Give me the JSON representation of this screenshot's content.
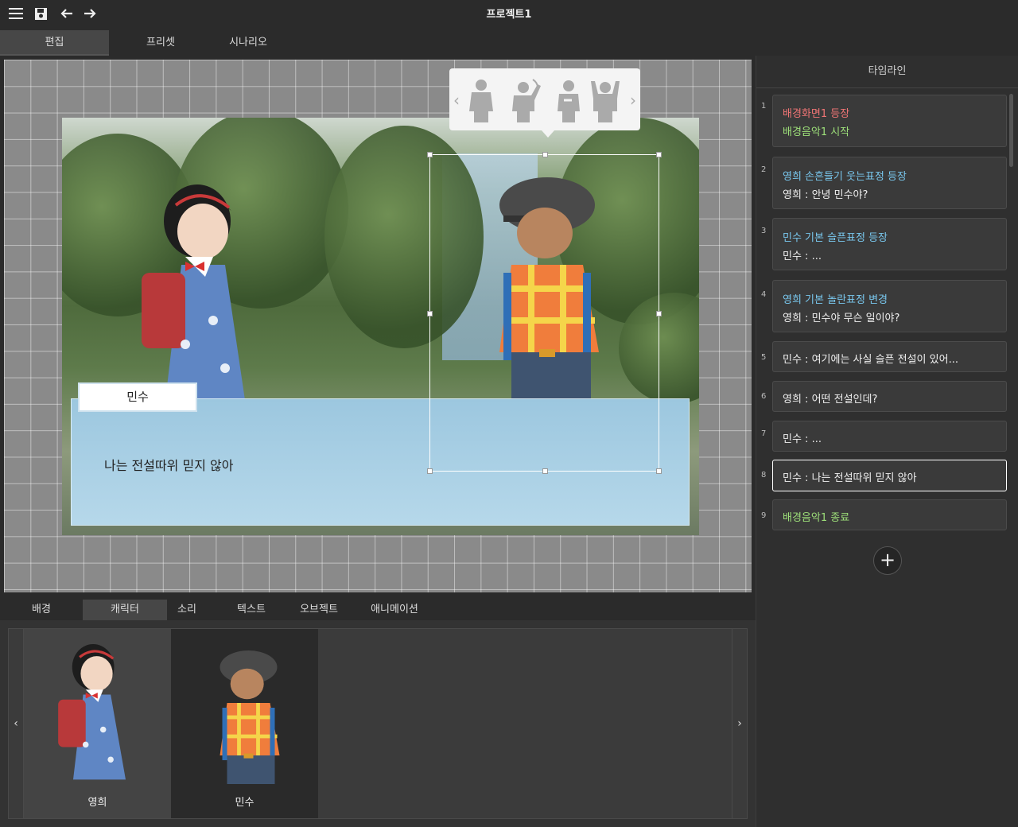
{
  "app": {
    "title": "프로젝트1",
    "icons": [
      "menu-icon",
      "save-icon",
      "undo-icon",
      "redo-icon"
    ]
  },
  "main_tabs": [
    {
      "label": "편집",
      "active": true
    },
    {
      "label": "프리셋",
      "active": false
    },
    {
      "label": "시나리오",
      "active": false
    }
  ],
  "stage": {
    "speaker_name": "민수",
    "dialog_text": "나는 전설따위 믿지 않아",
    "pose_popup": {
      "poses": [
        "pose-standing-icon",
        "pose-wave-hand-icon",
        "pose-thinking-icon",
        "pose-hands-up-icon"
      ]
    }
  },
  "timeline": {
    "title": "타임라인",
    "items": [
      {
        "num": "1",
        "lines": [
          {
            "text": "배경화면1 등장",
            "color": "red"
          },
          {
            "text": "배경음악1 시작",
            "color": "green"
          }
        ]
      },
      {
        "num": "2",
        "lines": [
          {
            "text": "영희 손흔들기 웃는표정 등장",
            "color": "blue"
          },
          {
            "text": "영희 : 안녕 민수야?",
            "color": "white"
          }
        ]
      },
      {
        "num": "3",
        "lines": [
          {
            "text": "민수 기본 슬픈표정 등장",
            "color": "blue"
          },
          {
            "text": "민수 : ...",
            "color": "white"
          }
        ]
      },
      {
        "num": "4",
        "lines": [
          {
            "text": "영희 기본 놀란표정 변경",
            "color": "blue"
          },
          {
            "text": "영희 : 민수야 무슨 일이야?",
            "color": "white"
          }
        ]
      },
      {
        "num": "5",
        "lines": [
          {
            "text": "민수 : 여기에는 사실 슬픈 전설이 있어...",
            "color": "white"
          }
        ]
      },
      {
        "num": "6",
        "lines": [
          {
            "text": "영희 : 어떤 전설인데?",
            "color": "white"
          }
        ]
      },
      {
        "num": "7",
        "lines": [
          {
            "text": "민수 : ...",
            "color": "white"
          }
        ]
      },
      {
        "num": "8",
        "lines": [
          {
            "text": "민수 : 나는 전설따위 믿지 않아",
            "color": "white"
          }
        ],
        "active": true
      },
      {
        "num": "9",
        "lines": [
          {
            "text": "배경음악1 종료",
            "color": "green"
          }
        ]
      }
    ],
    "add_label": "+"
  },
  "bottom_tabs": [
    {
      "label": "배경",
      "active": false
    },
    {
      "label": "캐릭터",
      "active": true
    },
    {
      "label": "소리",
      "active": false
    },
    {
      "label": "텍스트",
      "active": false
    },
    {
      "label": "오브젝트",
      "active": false
    },
    {
      "label": "애니메이션",
      "active": false
    }
  ],
  "library": {
    "prev_label": "‹",
    "next_label": "›",
    "characters": [
      {
        "name": "영희",
        "selected": false
      },
      {
        "name": "민수",
        "selected": true
      }
    ]
  },
  "colors": {
    "red": "#f07575",
    "green": "#9ee07a",
    "blue": "#79c8ef",
    "white": "#f0f0f0"
  }
}
